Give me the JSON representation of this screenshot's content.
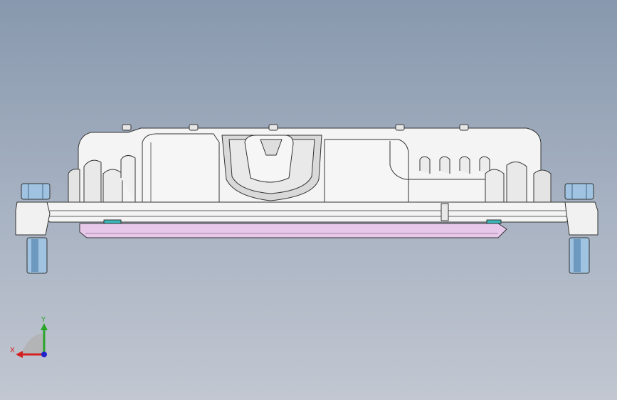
{
  "viewport": {
    "background_top": "#8898ad",
    "background_bottom": "#c2c7d1"
  },
  "model": {
    "name": "housing-part-front-view",
    "outline_color": "#333333",
    "body_fill": "#f4f4f4",
    "shadow_fill": "#d9d9d9",
    "gasket_fill": "#e8c8ea",
    "bolt_fill": "#9fc3e0",
    "bolt_dark": "#6d98c0",
    "teal_accent": "#3bb7b7"
  },
  "triad": {
    "x_label": "X",
    "y_label": "Y",
    "x_color": "#d42020",
    "y_color": "#2aa52a",
    "z_color": "#2222cc"
  }
}
